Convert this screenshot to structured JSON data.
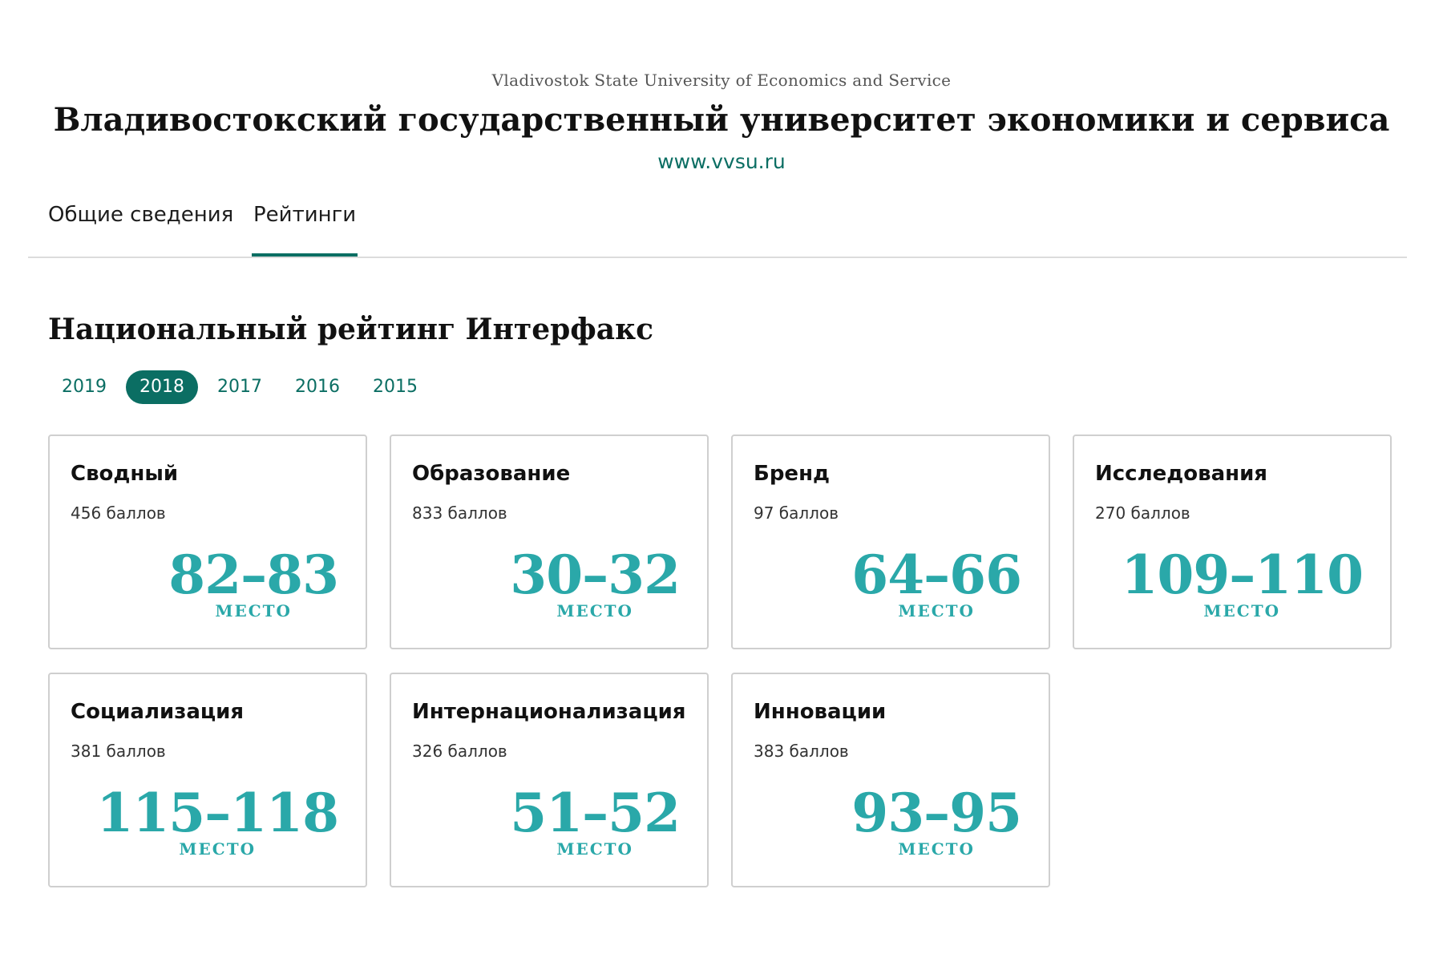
{
  "header": {
    "subtitle": "Vladivostok State University of Economics and Service",
    "title": "Владивостокский государственный университет экономики и сервиса",
    "site": "www.vvsu.ru"
  },
  "tabs": [
    {
      "label": "Общие сведения",
      "active": false
    },
    {
      "label": "Рейтинги",
      "active": true
    }
  ],
  "section": {
    "title": "Национальный рейтинг Интерфакс",
    "years": [
      "2019",
      "2018",
      "2017",
      "2016",
      "2015"
    ],
    "selected_year": "2018"
  },
  "cards": [
    {
      "title": "Сводный",
      "score": "456 баллов",
      "rank": "82–83",
      "unit": "МЕСТО"
    },
    {
      "title": "Образование",
      "score": "833 баллов",
      "rank": "30–32",
      "unit": "МЕСТО"
    },
    {
      "title": "Бренд",
      "score": "97 баллов",
      "rank": "64–66",
      "unit": "МЕСТО"
    },
    {
      "title": "Исследования",
      "score": "270 баллов",
      "rank": "109–110",
      "unit": "МЕСТО"
    },
    {
      "title": "Социализация",
      "score": "381 баллов",
      "rank": "115–118",
      "unit": "МЕСТО"
    },
    {
      "title": "Интернационализация",
      "score": "326 баллов",
      "rank": "51–52",
      "unit": "МЕСТО"
    },
    {
      "title": "Инновации",
      "score": "383 баллов",
      "rank": "93–95",
      "unit": "МЕСТО"
    }
  ],
  "colors": {
    "accent": "#0b6e63",
    "rank": "#2aa8a9",
    "border": "#cfcfcf"
  }
}
